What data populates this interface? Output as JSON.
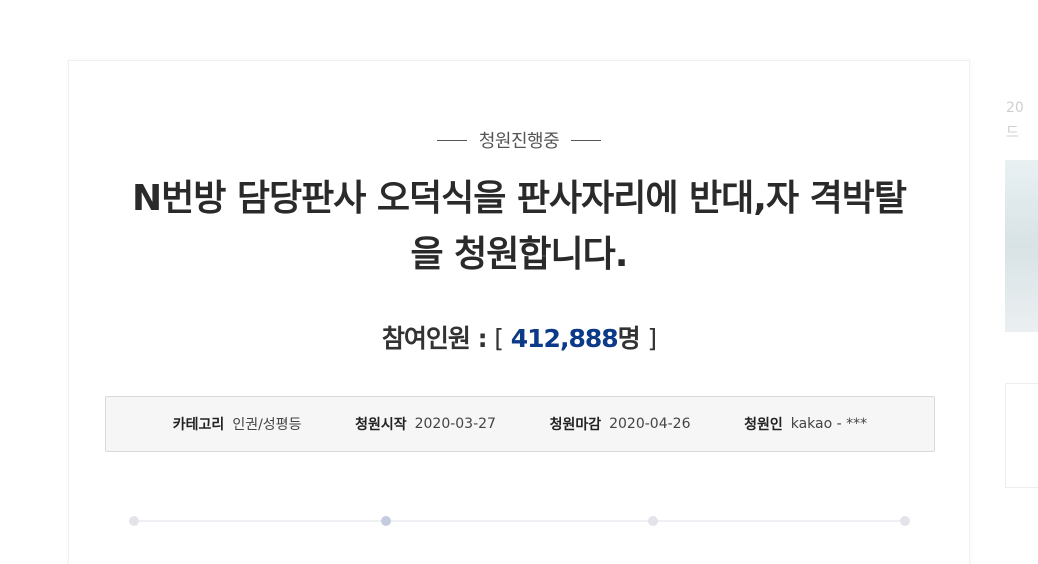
{
  "petition": {
    "status": "청원진행중",
    "title": "N번방 담당판사 오덕식을 판사자리에 반대,자 격박탈을 청원합니다.",
    "participants_label": "참여인원 :",
    "participants_count": "412,888",
    "participants_unit": "명",
    "info": {
      "category_label": "카테고리",
      "category_value": "인권/성평등",
      "start_label": "청원시작",
      "start_value": "2020-03-27",
      "end_label": "청원마감",
      "end_value": "2020-04-26",
      "author_label": "청원인",
      "author_value": "kakao - ***"
    },
    "progress_steps": [
      "",
      "",
      "",
      ""
    ],
    "progress_active_step": 1
  },
  "sidebar": {
    "line1": "20",
    "line2": "드"
  },
  "colors": {
    "count": "#0b3a88",
    "info_bg": "#f6f6f6"
  }
}
